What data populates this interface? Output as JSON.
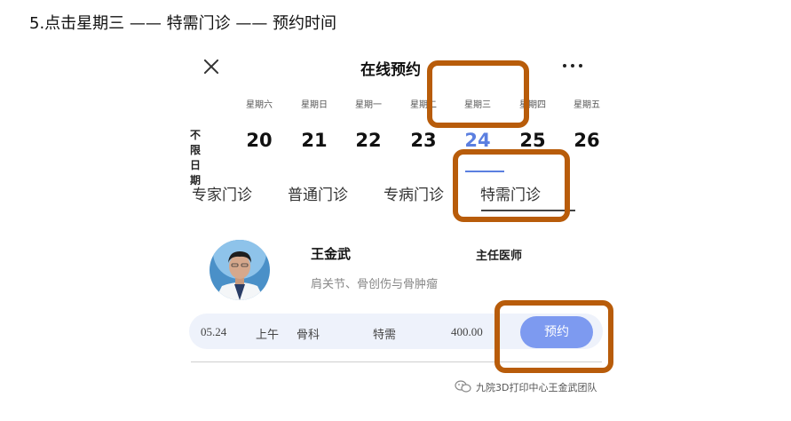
{
  "step_title": "5.点击星期三 —— 特需门诊 —— 预约时间",
  "header": {
    "title": "在线预约"
  },
  "date_selector": {
    "unlimited_label_line1": "不 限",
    "unlimited_label_line2": "日 期",
    "days": [
      {
        "weekday": "星期六",
        "date": "20"
      },
      {
        "weekday": "星期日",
        "date": "21"
      },
      {
        "weekday": "星期一",
        "date": "22"
      },
      {
        "weekday": "星期二",
        "date": "23"
      },
      {
        "weekday": "星期三",
        "date": "24"
      },
      {
        "weekday": "星期四",
        "date": "25"
      },
      {
        "weekday": "星期五",
        "date": "26"
      }
    ],
    "selected_index": 4
  },
  "tabs": [
    "专家门诊",
    "普通门诊",
    "专病门诊",
    "特需门诊"
  ],
  "doctor": {
    "name": "王金武",
    "title": "主任医师",
    "specialty": "肩关节、骨创伤与骨肿瘤"
  },
  "appointment": {
    "date": "05.24",
    "period": "上午",
    "department": "骨科",
    "type": "特需",
    "fee": "400.00",
    "book_label": "预约"
  },
  "watermark": "九院3D打印中心王金武团队",
  "colors": {
    "accent_blue": "#5b7fe0",
    "button_blue": "#7d9af0",
    "highlight_orange": "#b85c0a",
    "row_bg": "#eef2fb"
  },
  "icons": [
    "close-icon",
    "more-icon",
    "wechat-icon"
  ]
}
